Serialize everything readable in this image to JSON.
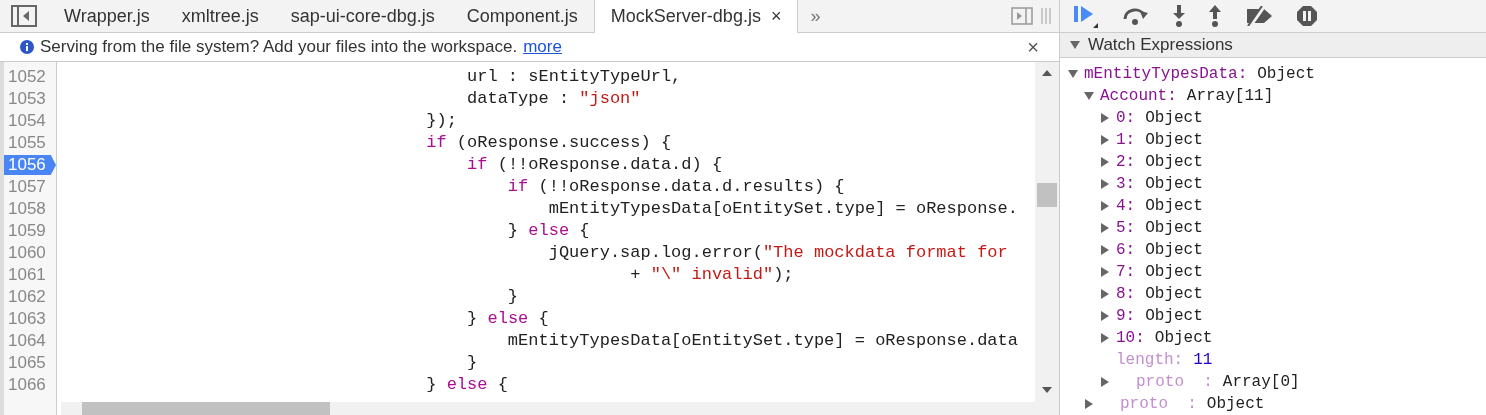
{
  "tabs": [
    {
      "label": "Wrapper.js",
      "selected": false
    },
    {
      "label": "xmltree.js",
      "selected": false
    },
    {
      "label": "sap-ui-core-dbg.js",
      "selected": false
    },
    {
      "label": "Component.js",
      "selected": false
    },
    {
      "label": "MockServer-dbg.js",
      "selected": true,
      "close": "×"
    }
  ],
  "tab_overflow": "»",
  "info_bar": {
    "message": "Serving from the file system? Add your files into the workspace.",
    "link": "more",
    "close": "×"
  },
  "code": {
    "lines": [
      {
        "number": "1052",
        "breakpoint": false,
        "tokens": [
          {
            "kind": "plain",
            "text": "                                        url : sEntityTypeUrl,"
          }
        ]
      },
      {
        "number": "1053",
        "breakpoint": false,
        "tokens": [
          {
            "kind": "plain",
            "text": "                                        dataType : "
          },
          {
            "kind": "string",
            "text": "\"json\""
          }
        ]
      },
      {
        "number": "1054",
        "breakpoint": false,
        "tokens": [
          {
            "kind": "plain",
            "text": "                                    });"
          }
        ]
      },
      {
        "number": "1055",
        "breakpoint": false,
        "tokens": [
          {
            "kind": "keyword",
            "text": "                                    if"
          },
          {
            "kind": "plain",
            "text": " (oResponse.success) {"
          }
        ]
      },
      {
        "number": "1056",
        "breakpoint": true,
        "tokens": [
          {
            "kind": "keyword",
            "text": "                                        if"
          },
          {
            "kind": "plain",
            "text": " (!!oResponse.data.d) {"
          }
        ]
      },
      {
        "number": "1057",
        "breakpoint": false,
        "tokens": [
          {
            "kind": "keyword",
            "text": "                                            if"
          },
          {
            "kind": "plain",
            "text": " (!!oResponse.data.d.results) {"
          }
        ]
      },
      {
        "number": "1058",
        "breakpoint": false,
        "tokens": [
          {
            "kind": "plain",
            "text": "                                                mEntityTypesData[oEntitySet.type] = oResponse."
          }
        ]
      },
      {
        "number": "1059",
        "breakpoint": false,
        "tokens": [
          {
            "kind": "plain",
            "text": "                                            } "
          },
          {
            "kind": "keyword",
            "text": "else"
          },
          {
            "kind": "plain",
            "text": " {"
          }
        ]
      },
      {
        "number": "1060",
        "breakpoint": false,
        "tokens": [
          {
            "kind": "plain",
            "text": "                                                jQuery.sap.log.error("
          },
          {
            "kind": "string",
            "text": "\"The mockdata format for"
          }
        ]
      },
      {
        "number": "1061",
        "breakpoint": false,
        "tokens": [
          {
            "kind": "plain",
            "text": "                                                        + "
          },
          {
            "kind": "string",
            "text": "\"\\\" invalid\""
          },
          {
            "kind": "plain",
            "text": ");"
          }
        ]
      },
      {
        "number": "1062",
        "breakpoint": false,
        "tokens": [
          {
            "kind": "plain",
            "text": "                                            }"
          }
        ]
      },
      {
        "number": "1063",
        "breakpoint": false,
        "tokens": [
          {
            "kind": "plain",
            "text": "                                        } "
          },
          {
            "kind": "keyword",
            "text": "else"
          },
          {
            "kind": "plain",
            "text": " {"
          }
        ]
      },
      {
        "number": "1064",
        "breakpoint": false,
        "tokens": [
          {
            "kind": "plain",
            "text": "                                            mEntityTypesData[oEntitySet.type] = oResponse.data"
          }
        ]
      },
      {
        "number": "1065",
        "breakpoint": false,
        "tokens": [
          {
            "kind": "plain",
            "text": "                                        }"
          }
        ]
      },
      {
        "number": "1066",
        "breakpoint": false,
        "tokens": [
          {
            "kind": "plain",
            "text": "                                    } "
          },
          {
            "kind": "keyword",
            "text": "else"
          },
          {
            "kind": "plain",
            "text": " {"
          }
        ]
      }
    ]
  },
  "watch": {
    "title": "Watch Expressions",
    "expanded": true,
    "items": [
      {
        "kind": "node",
        "key": "mEntityTypesData:",
        "value": "Object",
        "color": "#222222",
        "dimmed": false,
        "expanded": true,
        "children": [
          {
            "kind": "node",
            "key": "Account:",
            "value": "Array[11]",
            "color": "#222222",
            "dimmed": false,
            "expanded": true,
            "children": [
              {
                "kind": "node",
                "key": "0:",
                "value": "Object",
                "color": "#222222",
                "dimmed": false,
                "expanded": false
              },
              {
                "kind": "node",
                "key": "1:",
                "value": "Object",
                "color": "#222222",
                "dimmed": false,
                "expanded": false
              },
              {
                "kind": "node",
                "key": "2:",
                "value": "Object",
                "color": "#222222",
                "dimmed": false,
                "expanded": false
              },
              {
                "kind": "node",
                "key": "3:",
                "value": "Object",
                "color": "#222222",
                "dimmed": false,
                "expanded": false
              },
              {
                "kind": "node",
                "key": "4:",
                "value": "Object",
                "color": "#222222",
                "dimmed": false,
                "expanded": false
              },
              {
                "kind": "node",
                "key": "5:",
                "value": "Object",
                "color": "#222222",
                "dimmed": false,
                "expanded": false
              },
              {
                "kind": "node",
                "key": "6:",
                "value": "Object",
                "color": "#222222",
                "dimmed": false,
                "expanded": false
              },
              {
                "kind": "node",
                "key": "7:",
                "value": "Object",
                "color": "#222222",
                "dimmed": false,
                "expanded": false
              },
              {
                "kind": "node",
                "key": "8:",
                "value": "Object",
                "color": "#222222",
                "dimmed": false,
                "expanded": false
              },
              {
                "kind": "node",
                "key": "9:",
                "value": "Object",
                "color": "#222222",
                "dimmed": false,
                "expanded": false
              },
              {
                "kind": "node",
                "key": "10:",
                "value": "Object",
                "color": "#222222",
                "dimmed": false,
                "expanded": false
              },
              {
                "kind": "leaf",
                "key": "length:",
                "value": "11",
                "color": "#1c00cf",
                "dimmed": true
              },
              {
                "kind": "node",
                "key": "proto  :",
                "value": "Array[0]",
                "color": "#222222",
                "dimmed": true,
                "expanded": false
              }
            ]
          },
          {
            "kind": "node",
            "key": "proto  :",
            "value": "Object",
            "color": "#222222",
            "dimmed": true,
            "expanded": false
          }
        ]
      }
    ]
  }
}
